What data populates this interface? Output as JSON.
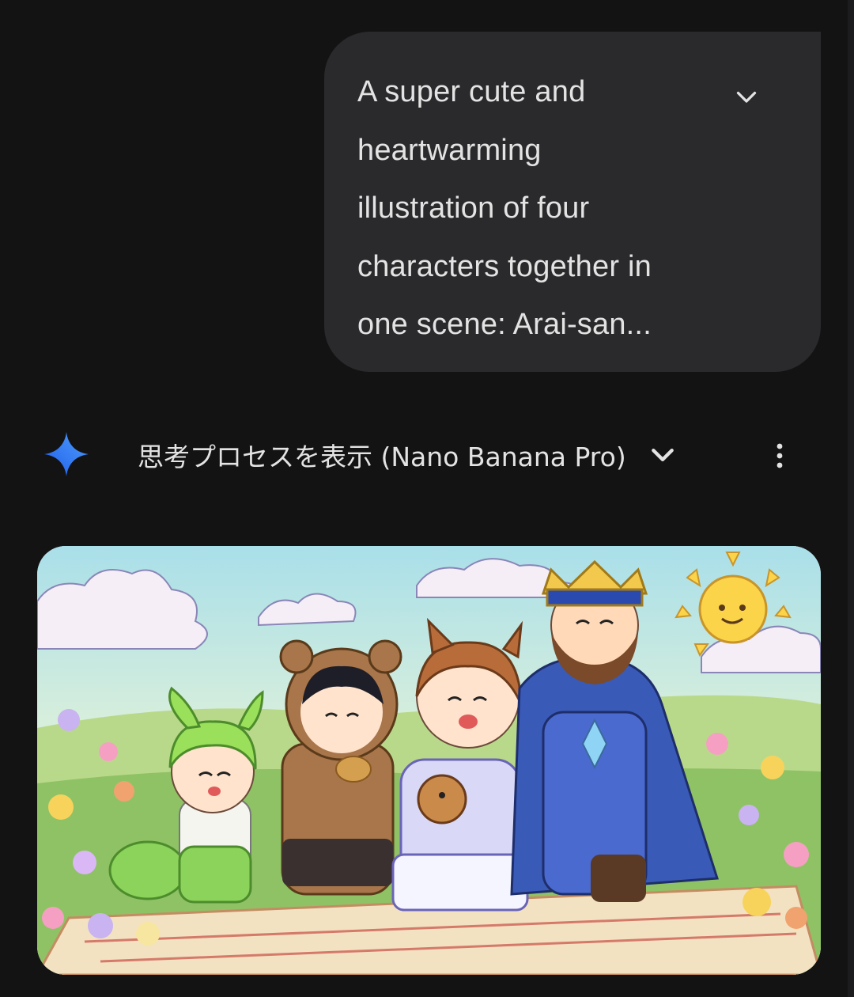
{
  "user_message": {
    "lines": [
      "A super cute and",
      "heartwarming",
      "illustration of four",
      "characters together in",
      "one scene: Arai-san..."
    ],
    "expand_icon": "chevron-down-icon"
  },
  "response": {
    "model_icon": "gemini-sparkle-icon",
    "thinking_label": "思考プロセスを表示 (Nano Banana Pro)",
    "thinking_toggle_icon": "chevron-down-icon",
    "more_icon": "more-vert-icon"
  },
  "generated_image": {
    "description_icon": "generated-illustration"
  },
  "colors": {
    "background": "#131314",
    "bubble": "#2a2a2c",
    "text": "#e3e3e3",
    "sparkle_blue": "#3a7bf2"
  }
}
